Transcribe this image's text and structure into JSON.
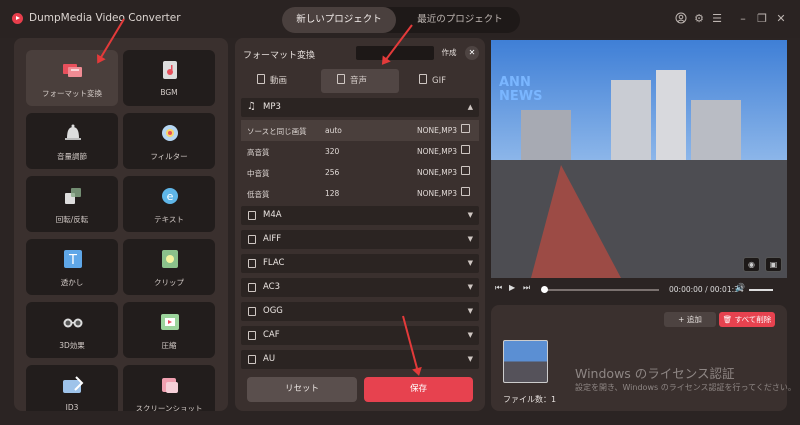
{
  "app": {
    "title": "DumpMedia Video Converter"
  },
  "project_tabs": {
    "new": "新しいプロジェクト",
    "recent": "最近のプロジェクト"
  },
  "tools": [
    {
      "label": "フォーマット変換",
      "icon": "format-convert-icon",
      "active": true
    },
    {
      "label": "BGM",
      "icon": "music-file-icon",
      "active": false
    },
    {
      "label": "音量調節",
      "icon": "bell-volume-icon",
      "active": false
    },
    {
      "label": "フィルター",
      "icon": "filter-icon",
      "active": false
    },
    {
      "label": "回転/反転",
      "icon": "rotate-icon",
      "active": false
    },
    {
      "label": "テキスト",
      "icon": "text-icon",
      "active": false
    },
    {
      "label": "透かし",
      "icon": "watermark-icon",
      "active": false
    },
    {
      "label": "クリップ",
      "icon": "clip-icon",
      "active": false
    },
    {
      "label": "3D効果",
      "icon": "3d-glasses-icon",
      "active": false
    },
    {
      "label": "圧縮",
      "icon": "compress-icon",
      "active": false
    },
    {
      "label": "ID3",
      "icon": "id3-icon",
      "active": false
    },
    {
      "label": "スクリーンショット",
      "icon": "screenshot-icon",
      "active": false
    }
  ],
  "format": {
    "title": "フォーマット変換",
    "create_label": "作成",
    "type_tabs": {
      "video": "動画",
      "audio": "音声",
      "gif": "GIF"
    },
    "groups": {
      "mp3": "MP3",
      "m4a": "M4A",
      "aiff": "AIFF",
      "flac": "FLAC",
      "ac3": "AC3",
      "ogg": "OGG",
      "caf": "CAF",
      "au": "AU"
    },
    "presets": [
      {
        "name": "ソースと同じ画質",
        "bitrate": "auto",
        "info": "NONE,MP3"
      },
      {
        "name": "高音質",
        "bitrate": "320",
        "info": "NONE,MP3"
      },
      {
        "name": "中音質",
        "bitrate": "256",
        "info": "NONE,MP3"
      },
      {
        "name": "低音質",
        "bitrate": "128",
        "info": "NONE,MP3"
      }
    ],
    "reset_label": "リセット",
    "save_label": "保存"
  },
  "preview": {
    "overlay_logo_1": "ANN",
    "overlay_logo_2": "NEWS"
  },
  "player": {
    "time": "00:00:00 / 00:01:34",
    "progress": 0.0
  },
  "files": {
    "add_label": "+ 追加",
    "delete_all_label": "すべて削除",
    "count_label": "ファイル数：1"
  },
  "license": {
    "title": "Windows のライセンス認証",
    "text": "設定を開き、Windows のライセンス認証を行ってください。"
  },
  "colors": {
    "accent": "#e7424f",
    "panel": "#3a302e",
    "background": "#2b2423",
    "arrow": "#e33a3a"
  }
}
